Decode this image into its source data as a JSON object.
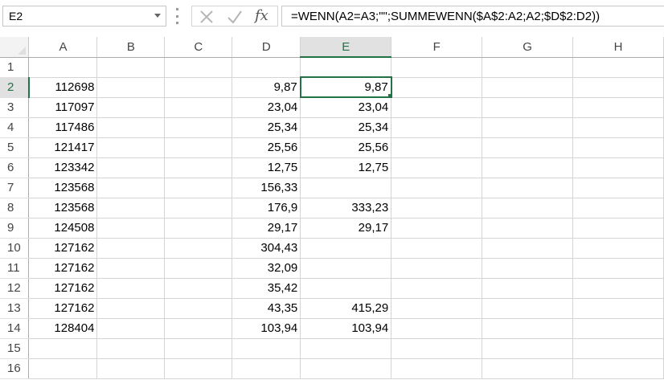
{
  "name_box": {
    "value": "E2"
  },
  "formula_bar": {
    "formula": "=WENN(A2=A3;\"\";SUMMEWENN($A$2:A2;A2;$D$2:D2))"
  },
  "icons": {
    "cancel": "close-icon",
    "enter": "checkmark-icon",
    "function": "fx-icon",
    "fx_label": "fx"
  },
  "colors": {
    "accent": "#217346",
    "grid_line": "#d4d4d4",
    "header_selected": "#e1e1e1"
  },
  "selection": {
    "cell": "E2",
    "column": "E",
    "row": "2"
  },
  "sheet": {
    "columns": [
      "A",
      "B",
      "C",
      "D",
      "E",
      "F",
      "G",
      "H"
    ],
    "rows": [
      {
        "num": "1",
        "A": "",
        "D": "",
        "E": ""
      },
      {
        "num": "2",
        "A": "112698",
        "D": "9,87",
        "E": "9,87"
      },
      {
        "num": "3",
        "A": "117097",
        "D": "23,04",
        "E": "23,04"
      },
      {
        "num": "4",
        "A": "117486",
        "D": "25,34",
        "E": "25,34"
      },
      {
        "num": "5",
        "A": "121417",
        "D": "25,56",
        "E": "25,56"
      },
      {
        "num": "6",
        "A": "123342",
        "D": "12,75",
        "E": "12,75"
      },
      {
        "num": "7",
        "A": "123568",
        "D": "156,33",
        "E": ""
      },
      {
        "num": "8",
        "A": "123568",
        "D": "176,9",
        "E": "333,23"
      },
      {
        "num": "9",
        "A": "124508",
        "D": "29,17",
        "E": "29,17"
      },
      {
        "num": "10",
        "A": "127162",
        "D": "304,43",
        "E": ""
      },
      {
        "num": "11",
        "A": "127162",
        "D": "32,09",
        "E": ""
      },
      {
        "num": "12",
        "A": "127162",
        "D": "35,42",
        "E": ""
      },
      {
        "num": "13",
        "A": "127162",
        "D": "43,35",
        "E": "415,29"
      },
      {
        "num": "14",
        "A": "128404",
        "D": "103,94",
        "E": "103,94"
      },
      {
        "num": "15",
        "A": "",
        "D": "",
        "E": ""
      },
      {
        "num": "16",
        "A": "",
        "D": "",
        "E": ""
      }
    ]
  }
}
